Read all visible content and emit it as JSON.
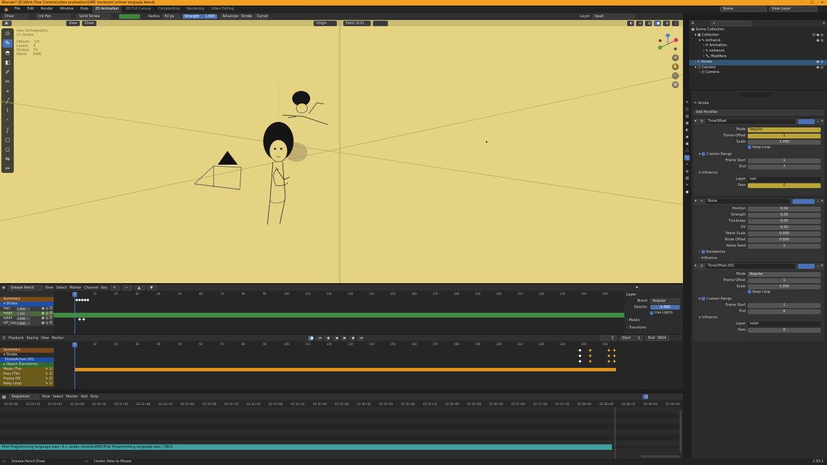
{
  "title": "Blender* [E:\\Work Flow Content\\video produktion\\DMC stories\\mi primer lenguaje.blend]",
  "menu": [
    "File",
    "Edit",
    "Render",
    "Window",
    "Help"
  ],
  "workspaces": [
    "2D Animation",
    "2D Full Canvas",
    "Compositing",
    "Rendering",
    "Video Editing"
  ],
  "active_workspace": "2D Animation",
  "scene": "Scene",
  "view_layer": "View Layer",
  "toolbar": {
    "mode": "Draw",
    "brush": "Ink Pen",
    "stroke": "Solid Stroke",
    "radius_label": "Radius",
    "radius_value": "60 px",
    "strength_label": "Strength",
    "strength_value": "1.000",
    "advanced": "Advanced",
    "stroke_menu": "Stroke",
    "cursor_menu": "Cursor",
    "layer_label": "Layer",
    "layer_value": "head"
  },
  "viewport": {
    "view_menu": "View",
    "draw_menu": "Draw",
    "origin": "Origin",
    "placement": "Point (X-Z)",
    "info_title": "User Orthographic",
    "info_sub": "(1) Stroke",
    "stats": [
      {
        "label": "Objects",
        "value": "1/3"
      },
      {
        "label": "Layers",
        "value": "5"
      },
      {
        "label": "Strokes",
        "value": "51"
      },
      {
        "label": "Points",
        "value": "3496"
      }
    ]
  },
  "dopesheet": {
    "editor": "Grease Pencil",
    "menus": [
      "View",
      "Select",
      "Marker",
      "Channel",
      "Key"
    ],
    "current_frame": "1",
    "ticks": [
      10,
      20,
      30,
      40,
      50,
      60,
      70,
      80,
      90,
      100,
      110,
      120,
      130,
      140,
      150,
      160,
      170,
      180,
      190,
      200,
      210,
      220,
      230,
      240,
      250
    ],
    "summary": "Summary",
    "object": "Stroke",
    "layers": [
      {
        "name": "hair",
        "opacity": "1.000"
      },
      {
        "name": "head",
        "opacity": "1.000"
      },
      {
        "name": "tshirt",
        "opacity": "1.000"
      },
      {
        "name": "GP_Layer",
        "opacity": "1.000"
      }
    ]
  },
  "layer_panel": {
    "title": "Layer",
    "blend_label": "Blend",
    "blend_value": "Regular",
    "opacity_label": "Opacity",
    "opacity_value": "1.000",
    "use_lights": "Use Lights",
    "masks": "Masks",
    "transform": "Transform"
  },
  "timeline": {
    "menus": [
      "Playback",
      "Keying",
      "View",
      "Marker"
    ],
    "current_frame": "1",
    "start_label": "Start",
    "start": "1",
    "end_label": "End",
    "end": "3804",
    "summary": "Summary",
    "object": "Stroke",
    "action": "StrokeAction.001",
    "group": "Object Transforms",
    "channels": [
      "Mode (Tim",
      "Pass (Tim",
      "Frame Off",
      "Keep Loop"
    ]
  },
  "sequencer": {
    "editor": "Sequencer",
    "menus": [
      "View",
      "Select",
      "Marker",
      "Add",
      "Strip"
    ],
    "times": [
      "02:29+08",
      "02:29+16",
      "02:30+00",
      "02:30+08",
      "02:30+16",
      "02:31+00",
      "02:31+08",
      "02:31+16",
      "02:32+00",
      "02:32+08",
      "02:32+16",
      "02:33+00",
      "02:33+08",
      "02:33+16",
      "02:34+00",
      "02:34+08",
      "02:34+16",
      "02:35+00",
      "02:35+08",
      "02:35+16",
      "02:36+00",
      "02:36+08",
      "02:36+16",
      "02:37+00",
      "02:37+08",
      "02:37+16",
      "02:38+00",
      "02:38+08",
      "02:38+16",
      "02:39+00",
      "02:39+08"
    ],
    "strip": "First Programming language.wav | E:\\..\\audio records\\DMC\\First Programming language.wav | 3801"
  },
  "status": {
    "left": "Grease Pencil Draw",
    "mid": "Center View to Mouse",
    "version": "2.93.1"
  },
  "outliner": {
    "title": "Scene Collection",
    "items": [
      {
        "label": "Collection",
        "indent": 1
      },
      {
        "label": "enfranck",
        "indent": 2
      },
      {
        "label": "Animation",
        "indent": 3
      },
      {
        "label": "enfranck",
        "indent": 3
      },
      {
        "label": "Modifiers",
        "indent": 3
      },
      {
        "label": "Stroke",
        "indent": 1,
        "selected": true
      },
      {
        "label": "Camera",
        "indent": 1
      },
      {
        "label": "Camera",
        "indent": 2
      }
    ]
  },
  "properties": {
    "object": "Stroke",
    "add_modifier": "Add Modifier",
    "mod1": {
      "name": "TimeOffset",
      "mode_label": "Mode",
      "mode": "Regular",
      "offset_label": "Frame Offset",
      "offset": "1",
      "scale_label": "Scale",
      "scale": "1.000",
      "keep_loop": "Keep Loop",
      "custom_range": "Custom Range",
      "fstart_label": "Frame Start",
      "fstart": "1",
      "end_label": "End",
      "end": "7",
      "influence": "Influence",
      "layer_label": "Layer",
      "layer": "hair",
      "pass_label": "Pass",
      "pass": "0"
    },
    "mod2": {
      "name": "Noise",
      "position_label": "Position",
      "position": "0.04",
      "strength_label": "Strength",
      "strength": "0.00",
      "thickness_label": "Thickness",
      "thickness": "0.00",
      "uv_label": "UV",
      "uv": "0.00",
      "nscale_label": "Noise Scale",
      "nscale": "0.000",
      "noffset_label": "Noise Offset",
      "noffset": "0.000",
      "nseed_label": "Noise Seed",
      "nseed": "1",
      "randomize": "Randomize",
      "influence": "Influence"
    },
    "mod3": {
      "name": "TimeOffset.001",
      "mode_label": "Mode",
      "mode": "Regular",
      "offset_label": "Frame Offset",
      "offset": "1",
      "scale_label": "Scale",
      "scale": "1.000",
      "keep_loop": "Keep Loop",
      "custom_range": "Custom Range",
      "fstart_label": "Frame Start",
      "fstart": "1",
      "end_label": "End",
      "end": "6",
      "influence": "Influence",
      "layer_label": "Layer",
      "layer": "tshirt",
      "pass_label": "Pass",
      "pass": "0"
    }
  }
}
